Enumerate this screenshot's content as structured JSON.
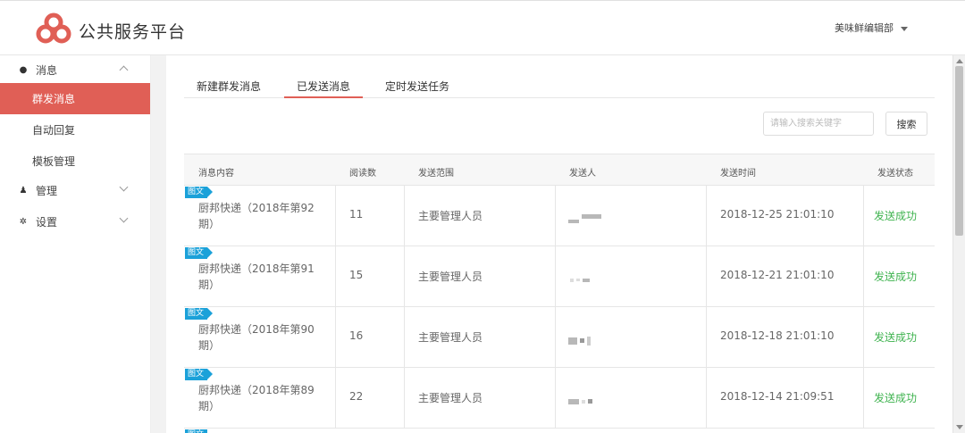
{
  "header": {
    "title": "公共服务平台",
    "user": "美味鲜编辑部",
    "brand_color": "#e05f56"
  },
  "sidebar": {
    "groups": [
      {
        "label": "消息",
        "icon": "chat-bubble-icon",
        "expanded": true,
        "items": [
          {
            "label": "群发消息",
            "active": true
          },
          {
            "label": "自动回复"
          },
          {
            "label": "模板管理"
          }
        ]
      },
      {
        "label": "管理",
        "icon": "user-icon",
        "expanded": false
      },
      {
        "label": "设置",
        "icon": "gear-icon",
        "expanded": false
      }
    ]
  },
  "tabs": [
    {
      "label": "新建群发消息"
    },
    {
      "label": "已发送消息",
      "active": true
    },
    {
      "label": "定时发送任务"
    }
  ],
  "search": {
    "placeholder": "请输入搜索关键字",
    "button": "搜索"
  },
  "table": {
    "columns": [
      "消息内容",
      "阅读数",
      "发送范围",
      "发送人",
      "发送时间",
      "发送状态"
    ],
    "badge": "图文",
    "rows": [
      {
        "title": "厨邦快递（2018年第92期）",
        "reads": "11",
        "scope": "主要管理人员",
        "sender": "(redacted)",
        "time": "2018-12-25 21:01:10",
        "status": "发送成功"
      },
      {
        "title": "厨邦快递（2018年第91期）",
        "reads": "15",
        "scope": "主要管理人员",
        "sender": "(redacted)",
        "time": "2018-12-21 21:01:10",
        "status": "发送成功"
      },
      {
        "title": "厨邦快递（2018年第90期）",
        "reads": "16",
        "scope": "主要管理人员",
        "sender": "(redacted)",
        "time": "2018-12-18 21:01:10",
        "status": "发送成功"
      },
      {
        "title": "厨邦快递（2018年第89期）",
        "reads": "22",
        "scope": "主要管理人员",
        "sender": "(redacted)",
        "time": "2018-12-14 21:09:51",
        "status": "发送成功"
      }
    ],
    "status_color": "#3fb34f",
    "badge_color": "#1ba1d9"
  }
}
